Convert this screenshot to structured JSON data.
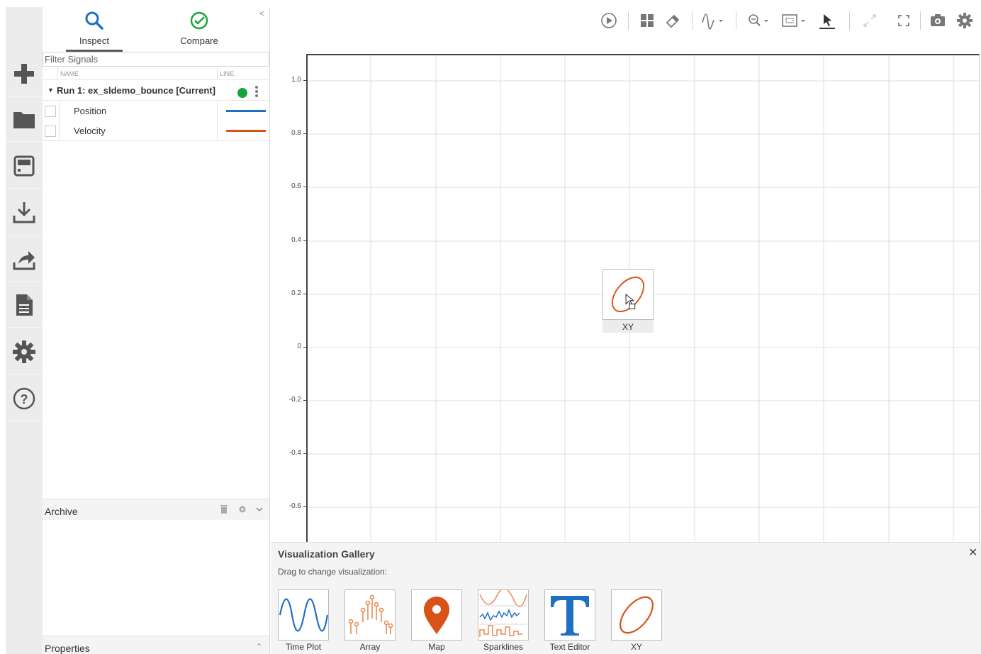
{
  "rail": {
    "items": [
      "new-icon",
      "folder-icon",
      "save-icon",
      "download-icon",
      "share-icon",
      "report-icon",
      "settings-icon",
      "help-icon"
    ]
  },
  "tabs": {
    "inspect": "Inspect",
    "compare": "Compare"
  },
  "filter": {
    "placeholder": "Filter Signals"
  },
  "columns": {
    "name": "NAME",
    "line": "LINE"
  },
  "run": {
    "name": "Run 1: ex_sldemo_bounce [Current]",
    "status_color": "#19a43b"
  },
  "signals": [
    {
      "label": "Position",
      "color": "#1f6fc2"
    },
    {
      "label": "Velocity",
      "color": "#d95319"
    }
  ],
  "archive": {
    "title": "Archive"
  },
  "properties": {
    "title": "Properties"
  },
  "plot": {
    "y_ticks": [
      "1.0",
      "0.8",
      "0.6",
      "0.4",
      "0.2",
      "0",
      "-0.2",
      "-0.4",
      "-0.6"
    ],
    "drag_label": "XY"
  },
  "gallery": {
    "title": "Visualization Gallery",
    "subtitle": "Drag to change visualization:",
    "items": [
      {
        "label": "Time Plot",
        "icon": "time-plot-icon"
      },
      {
        "label": "Array",
        "icon": "array-icon"
      },
      {
        "label": "Map",
        "icon": "map-icon"
      },
      {
        "label": "Sparklines",
        "icon": "sparklines-icon"
      },
      {
        "label": "Text Editor",
        "icon": "text-editor-icon"
      },
      {
        "label": "XY",
        "icon": "xy-icon"
      }
    ]
  },
  "colors": {
    "accent_blue": "#1f6fc2",
    "accent_orange": "#d95319",
    "compare_green": "#19a43b",
    "rail_icon": "#555555"
  }
}
